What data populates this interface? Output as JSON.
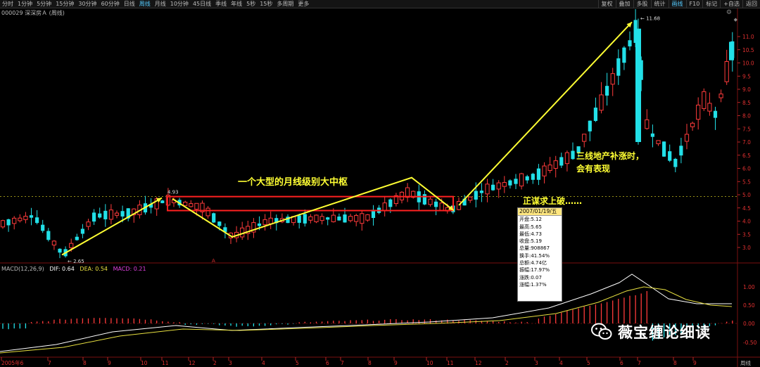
{
  "toolbar": {
    "tabs": [
      "分时",
      "1分钟",
      "5分钟",
      "15分钟",
      "30分钟",
      "60分钟",
      "日线",
      "周线",
      "月线",
      "10分钟",
      "45日线",
      "季线",
      "年线",
      "5秒",
      "15秒",
      "多周期",
      "更多"
    ],
    "active_tab": "周线",
    "right_buttons": [
      "复权",
      "叠加",
      "多股",
      "统计",
      "画线",
      "F10",
      "标记",
      "+自选",
      "返回"
    ],
    "active_right": "画线"
  },
  "stock": {
    "title": "000029 深深房Ａ (周线)"
  },
  "price_axis": {
    "ticks": [
      "11.0",
      "10.5",
      "10.0",
      "9.5",
      "9.0",
      "8.5",
      "8.0",
      "7.5",
      "7.0",
      "6.5",
      "6.0",
      "5.5",
      "5.0",
      "4.5",
      "4.0",
      "3.5",
      "3.0"
    ],
    "side_label": "周线"
  },
  "macd_axis": {
    "ticks": [
      "1.00",
      "0.50",
      "0.00",
      "-0.50"
    ]
  },
  "time_axis": {
    "labels": [
      "2005年6",
      "7",
      "8",
      "9",
      "10",
      "11",
      "12",
      "2",
      "3",
      "4",
      "5",
      "6",
      "7",
      "8",
      "9",
      "10",
      "11",
      "12",
      "2",
      "3",
      "4",
      "5",
      "6",
      "7",
      "8",
      "9"
    ]
  },
  "annotations": {
    "low_price": "2.65",
    "high_price_left": "4.93",
    "high_price_right": "11.68",
    "pivot_text": "一个大型的月线级别大中枢",
    "breakout_text": "正谋求上破……",
    "tier3_text_line1": "三线地产补涨时，",
    "tier3_text_line2": "会有表现",
    "marker_letter": "A"
  },
  "info_box": {
    "date": "2007/01/19/五",
    "rows": [
      "开盘:5.12",
      "最高:5.65",
      "最低:4.73",
      "收盘:5.19",
      "总量:908867",
      "换手:41.54%",
      "总额:4.74亿",
      "振幅:17.97%",
      "涨跌:0.07",
      "涨幅:1.37%"
    ]
  },
  "macd": {
    "name": "MACD(12,26,9)",
    "dif": "DIF: 0.64",
    "dea": "DEA: 0.54",
    "macd": "MACD: 0.21"
  },
  "watermark": {
    "text": "薇宝缠论细读"
  },
  "colors": {
    "up": "#ff3b3b",
    "down": "#22e0e8",
    "dif": "#ffffff",
    "dea": "#e8e040",
    "arrow": "#ffff33",
    "box": "#ff2020"
  }
}
